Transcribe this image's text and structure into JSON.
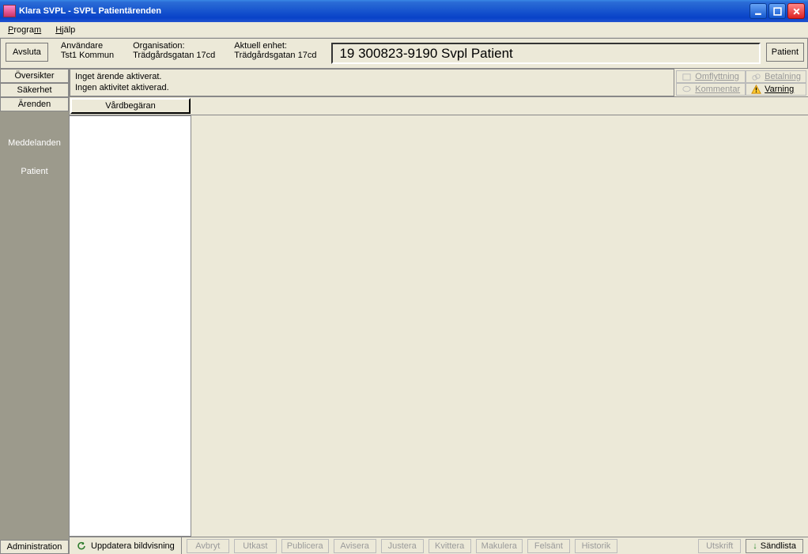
{
  "window": {
    "title": "Klara SVPL  -  SVPL Patientärenden"
  },
  "menu": {
    "program": "Program",
    "hjalp": "Hjälp"
  },
  "topbar": {
    "avsluta": "Avsluta",
    "anvandare_label": "Användare",
    "anvandare_value": "Tst1 Kommun",
    "organisation_label": "Organisation:",
    "organisation_value": "Trädgårdsgatan 17cd",
    "enhet_label": "Aktuell enhet:",
    "enhet_value": "Trädgårdsgatan 17cd",
    "patient_id": "19 300823-9190 Svpl Patient",
    "patient_btn": "Patient"
  },
  "sidebar": {
    "tabs": [
      "Översikter",
      "Säkerhet",
      "Ärenden"
    ],
    "items": [
      "Meddelanden",
      "Patient"
    ],
    "admin": "Administration"
  },
  "status": {
    "line1": "Inget ärende aktiverat.",
    "line2": "Ingen aktivitet aktiverad.",
    "omflyttning": "Omflyttning",
    "betalning": "Betalning",
    "kommentar": "Kommentar",
    "varning": "Varning"
  },
  "vb": {
    "vardbegaran": "Vårdbegäran"
  },
  "refresh": "Uppdatera bildvisning",
  "bottom": {
    "avbryt": "Avbryt",
    "utkast": "Utkast",
    "publicera": "Publicera",
    "avisera": "Avisera",
    "justera": "Justera",
    "kvittera": "Kvittera",
    "makulera": "Makulera",
    "felsant": "Felsänt",
    "historik": "Historik",
    "utskrift": "Utskrift",
    "sandlista": "Sändlista"
  }
}
